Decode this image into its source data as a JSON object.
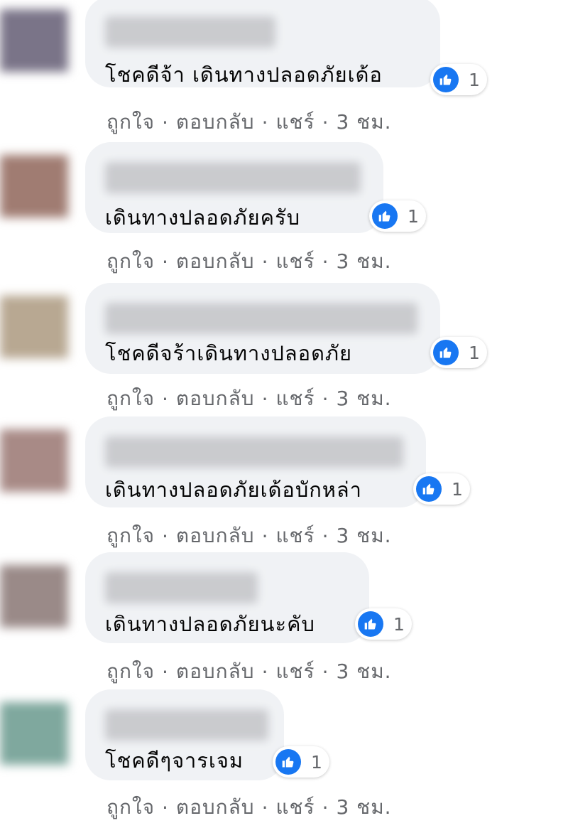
{
  "comments": [
    {
      "text": "โชคดีจ้า เดินทางปลอดภัยเด้อ",
      "likes": "1",
      "avatar_color": "#7a7488"
    },
    {
      "text": "เดินทางปลอดภัยครับ",
      "likes": "1",
      "avatar_color": "#a07c72"
    },
    {
      "text": "โชคดีจร้าเดินทางปลอดภัย",
      "likes": "1",
      "avatar_color": "#b8a892"
    },
    {
      "text": "เดินทางปลอดภัยเด้อบักหล่า",
      "likes": "1",
      "avatar_color": "#a88a86"
    },
    {
      "text": "เดินทางปลอดภัยนะคับ",
      "likes": "1",
      "avatar_color": "#9a8a88"
    },
    {
      "text": "โชคดีๆจารเจม",
      "likes": "1",
      "avatar_color": "#7fa89e"
    }
  ],
  "actions": {
    "like": "ถูกใจ",
    "reply": "ตอบกลับ",
    "share": "แชร์",
    "time": "3 ชม.",
    "separator": "·"
  },
  "colors": {
    "bubble": "#f0f2f5",
    "like_blue": "#1877f2",
    "meta_text": "#65676b"
  }
}
